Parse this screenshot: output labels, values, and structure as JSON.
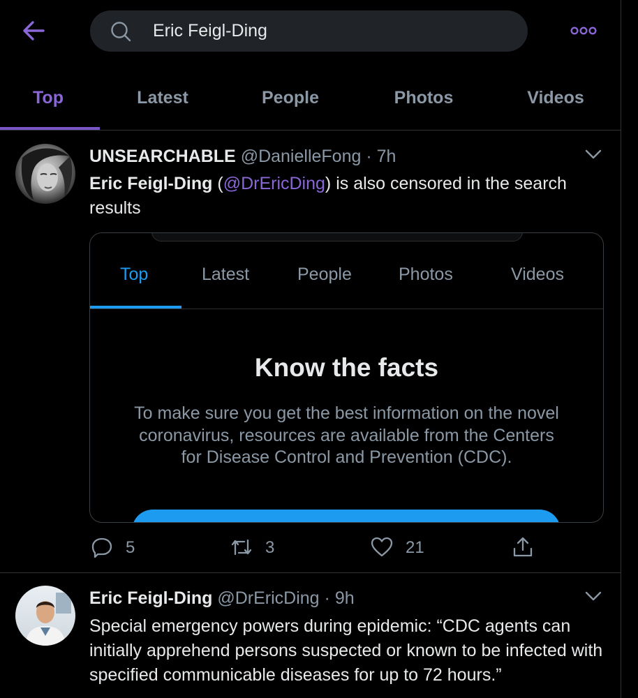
{
  "search": {
    "value": "Eric Feigl-Ding"
  },
  "tabs": [
    "Top",
    "Latest",
    "People",
    "Photos",
    "Videos"
  ],
  "tweets": [
    {
      "display_name": "UNSEARCHABLE",
      "handle": "@DanielleFong",
      "time": "· 7h",
      "body_bold": "Eric Feigl-Ding",
      "body_open": " (",
      "body_mention": "@DrEricDing",
      "body_rest": ") is also censored in the search results",
      "card": {
        "tabs": [
          "Top",
          "Latest",
          "People",
          "Photos",
          "Videos"
        ],
        "title": "Know the facts",
        "text": "To make sure you get the best information on the novel coronavirus, resources are available from the Centers for Disease Control and Prevention (CDC)."
      },
      "replies": "5",
      "retweets": "3",
      "likes": "21"
    },
    {
      "display_name": "Eric Feigl-Ding",
      "handle": "@DrEricDing",
      "time": "· 9h",
      "body": "Special emergency powers during epidemic: “CDC agents can initially apprehend persons suspected or known to be infected with specified communicable diseases for up to 72 hours.”"
    }
  ],
  "colors": {
    "accent": "#8a67d6",
    "card_accent": "#1d9bf0",
    "background": "#000000"
  }
}
